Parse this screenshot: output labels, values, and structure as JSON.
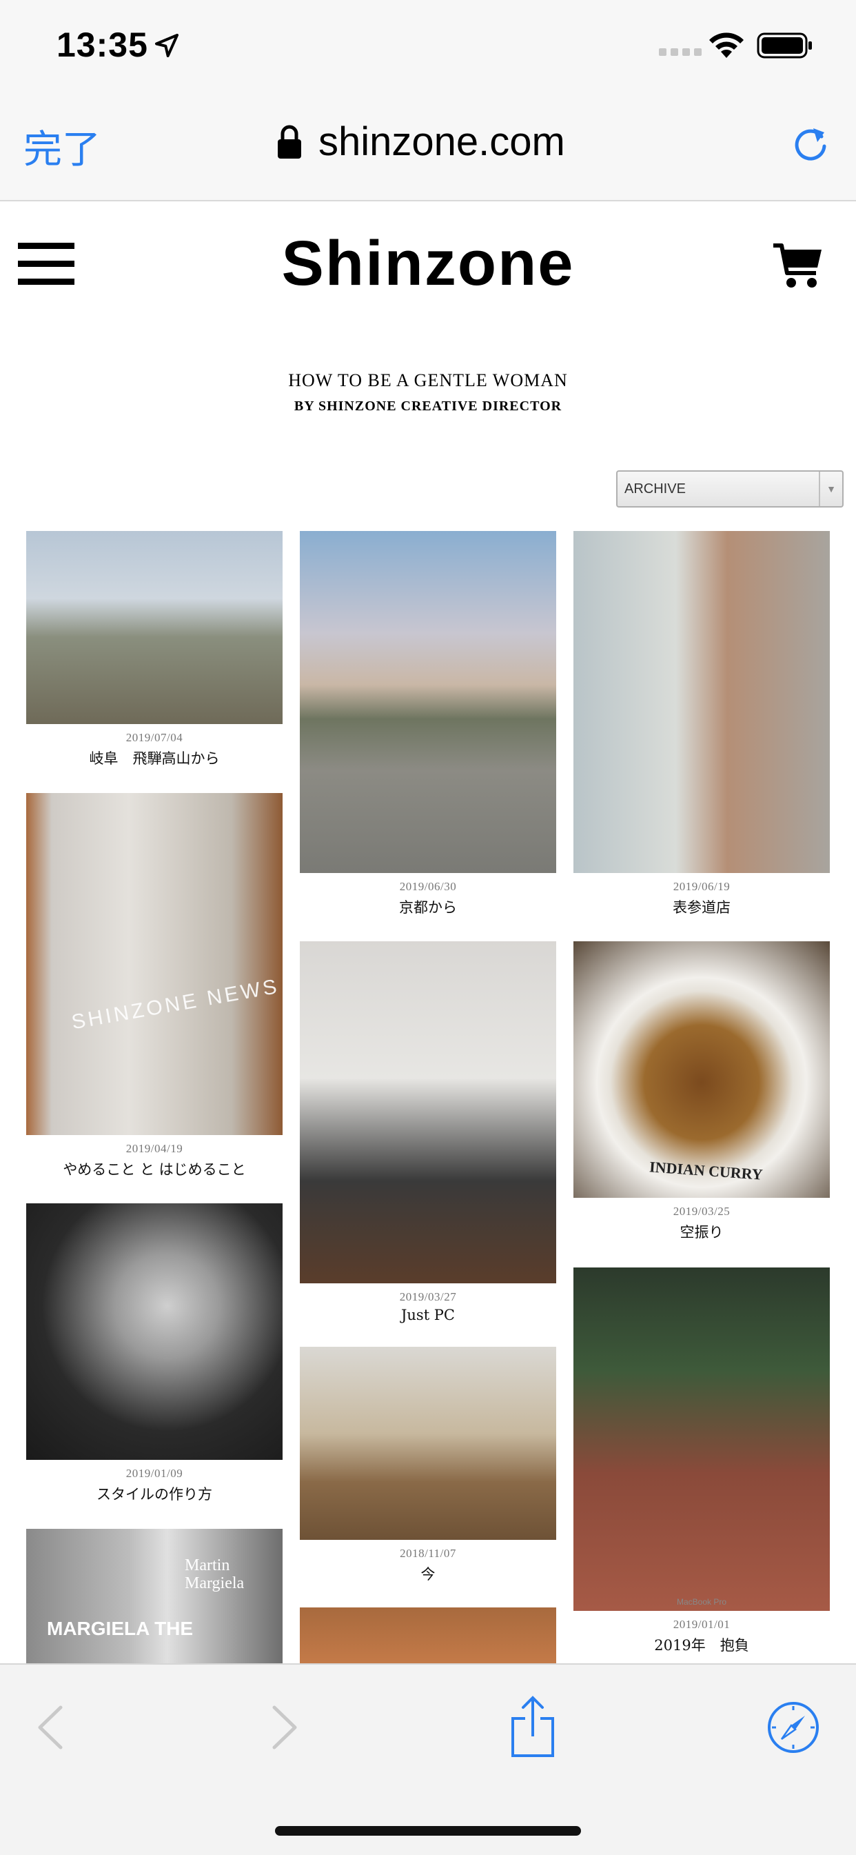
{
  "status_bar": {
    "time": "13:35"
  },
  "browser": {
    "done_label": "完了",
    "url": "shinzone.com"
  },
  "site": {
    "logo": "Shinzone",
    "blog_title": "HOW TO BE A GENTLE WOMAN",
    "blog_subtitle": "BY SHINZONE CREATIVE DIRECTOR",
    "archive_select": {
      "selected": "ARCHIVE"
    }
  },
  "posts": [
    {
      "date": "2019/07/04",
      "title": "岐阜　飛騨高山から"
    },
    {
      "date": "2019/06/30",
      "title": "京都から"
    },
    {
      "date": "2019/06/19",
      "title": "表参道店"
    },
    {
      "date": "2019/04/19",
      "title": "やめること と はじめること",
      "image_text": "SHINZONE NEWS"
    },
    {
      "date": "2019/03/27",
      "title": "Just PC"
    },
    {
      "date": "2019/03/25",
      "title": "空振り",
      "image_text": "INDIAN CURRY"
    },
    {
      "date": "2019/01/09",
      "title": "スタイルの作り方"
    },
    {
      "date": "2018/11/07",
      "title": "今"
    },
    {
      "date": "2019/01/01",
      "title": "2019年　抱負",
      "image_text": "MacBook Pro"
    }
  ],
  "partial_posts": {
    "books_image_text": "MARGIELA THE",
    "books_image_text2": "Martin Margiela"
  },
  "colors": {
    "ios_blue": "#2a7ff0",
    "chrome_bg": "#f7f7f7"
  },
  "icons": [
    "location-arrow-icon",
    "wifi-icon",
    "battery-icon",
    "lock-icon",
    "reload-icon",
    "menu-icon",
    "cart-icon",
    "back-icon",
    "forward-icon",
    "share-icon",
    "compass-icon"
  ]
}
